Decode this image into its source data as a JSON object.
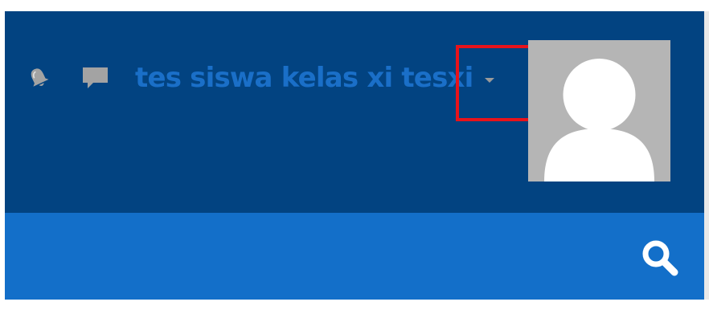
{
  "header": {
    "notifications_icon": "bell-icon",
    "messages_icon": "chat-bubble-icon",
    "user_name": "tes siswa kelas xi tesxi",
    "dropdown_icon": "caret-down-icon",
    "avatar_icon": "default-user-silhouette"
  },
  "navbar": {
    "search_icon": "search-icon"
  },
  "colors": {
    "header_bg": "#024381",
    "navbar_bg": "#136fc9",
    "user_name": "#1a6fc8",
    "icon_gray": "#9a9a9a",
    "avatar_bg": "#b5b5b5",
    "highlight": "#e8131b"
  }
}
